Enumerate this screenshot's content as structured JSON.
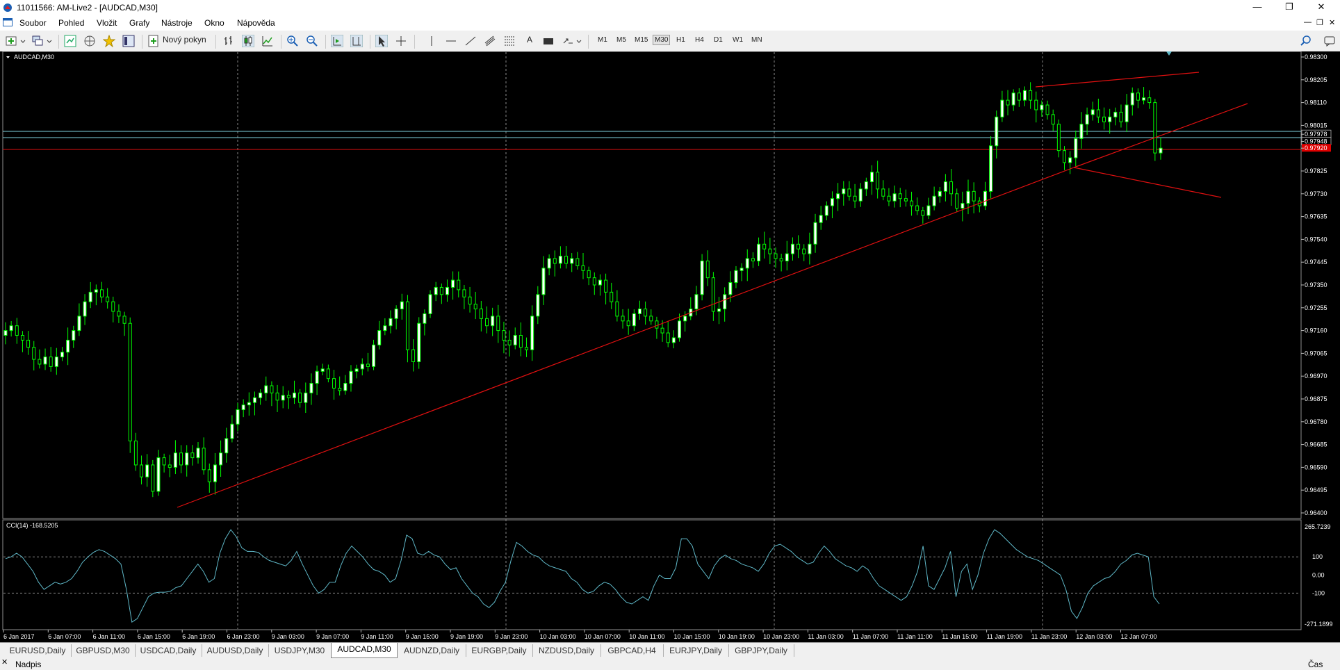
{
  "window": {
    "title": "11011566: AM-Live2 - [AUDCAD,M30]"
  },
  "menu": [
    "Soubor",
    "Pohled",
    "Vložit",
    "Grafy",
    "Nástroje",
    "Okno",
    "Nápověda"
  ],
  "toolbar": {
    "new_order_label": "Nový pokyn",
    "timeframes": [
      "M1",
      "M5",
      "M15",
      "M30",
      "H1",
      "H4",
      "D1",
      "W1",
      "MN"
    ],
    "active_timeframe": "M30",
    "text_tool_label": "A"
  },
  "chart": {
    "symbol_label": "AUDCAD,M30",
    "price_labels": [
      "0.98300",
      "0.98205",
      "0.98110",
      "0.98015",
      "0.97978",
      "0.97948",
      "0.97920",
      "0.97825",
      "0.97730",
      "0.97635",
      "0.97540",
      "0.97445",
      "0.97350",
      "0.97255",
      "0.97160",
      "0.97065",
      "0.96970",
      "0.96875",
      "0.96780",
      "0.96685",
      "0.96590",
      "0.96495",
      "0.96400"
    ],
    "current_price": "0.97920",
    "time_labels": [
      "6 Jan 2017",
      "6 Jan 07:00",
      "6 Jan 11:00",
      "6 Jan 15:00",
      "6 Jan 19:00",
      "6 Jan 23:00",
      "9 Jan 03:00",
      "9 Jan 07:00",
      "9 Jan 11:00",
      "9 Jan 15:00",
      "9 Jan 19:00",
      "9 Jan 23:00",
      "10 Jan 03:00",
      "10 Jan 07:00",
      "10 Jan 11:00",
      "10 Jan 15:00",
      "10 Jan 19:00",
      "10 Jan 23:00",
      "11 Jan 03:00",
      "11 Jan 07:00",
      "11 Jan 11:00",
      "11 Jan 15:00",
      "11 Jan 19:00",
      "11 Jan 23:00",
      "12 Jan 03:00",
      "12 Jan 07:00"
    ],
    "colors": {
      "background": "#000000",
      "candle": "#00ff00",
      "bull_body": "#ffffff",
      "trendline": "#e01010",
      "cci": "#5fb8c8",
      "ask_line": "#7fd4e0",
      "price_tag": "#e00000"
    },
    "close_series": [
      0.9716,
      0.9718,
      0.9714,
      0.9712,
      0.9709,
      0.9704,
      0.9702,
      0.9705,
      0.9701,
      0.9705,
      0.9707,
      0.9712,
      0.9716,
      0.9722,
      0.9728,
      0.9732,
      0.9733,
      0.973,
      0.9728,
      0.9724,
      0.9722,
      0.9719,
      0.967,
      0.966,
      0.9655,
      0.966,
      0.9649,
      0.9663,
      0.966,
      0.9659,
      0.9665,
      0.966,
      0.9665,
      0.9663,
      0.9667,
      0.9658,
      0.9653,
      0.966,
      0.9665,
      0.9671,
      0.9677,
      0.9683,
      0.9685,
      0.9686,
      0.9688,
      0.969,
      0.9693,
      0.969,
      0.9687,
      0.9689,
      0.9688,
      0.969,
      0.9686,
      0.969,
      0.9694,
      0.9699,
      0.97,
      0.9696,
      0.9692,
      0.9691,
      0.9694,
      0.9699,
      0.97,
      0.9702,
      0.9701,
      0.971,
      0.9716,
      0.9718,
      0.9721,
      0.9725,
      0.9728,
      0.9708,
      0.9703,
      0.9719,
      0.9723,
      0.9731,
      0.9734,
      0.9731,
      0.9734,
      0.9737,
      0.9733,
      0.973,
      0.9727,
      0.9725,
      0.9721,
      0.9718,
      0.9722,
      0.9716,
      0.9712,
      0.971,
      0.9714,
      0.9709,
      0.9708,
      0.9722,
      0.9731,
      0.9742,
      0.9746,
      0.9744,
      0.9747,
      0.9744,
      0.9746,
      0.9743,
      0.9741,
      0.9738,
      0.9735,
      0.9737,
      0.9732,
      0.9728,
      0.9722,
      0.972,
      0.9718,
      0.9723,
      0.9725,
      0.9722,
      0.972,
      0.9717,
      0.9715,
      0.9711,
      0.9713,
      0.972,
      0.9722,
      0.9725,
      0.9731,
      0.9745,
      0.9738,
      0.9724,
      0.9725,
      0.9731,
      0.9736,
      0.9741,
      0.9742,
      0.9746,
      0.9745,
      0.9752,
      0.975,
      0.9748,
      0.9746,
      0.9745,
      0.9748,
      0.9752,
      0.975,
      0.9748,
      0.9752,
      0.9761,
      0.9764,
      0.9768,
      0.9771,
      0.9773,
      0.9775,
      0.9772,
      0.977,
      0.9775,
      0.9778,
      0.9782,
      0.9775,
      0.9772,
      0.977,
      0.9773,
      0.9771,
      0.977,
      0.9768,
      0.9766,
      0.9764,
      0.9768,
      0.9772,
      0.9774,
      0.9778,
      0.9773,
      0.9767,
      0.9769,
      0.9774,
      0.977,
      0.9768,
      0.9774,
      0.9793,
      0.9805,
      0.9812,
      0.981,
      0.9815,
      0.9812,
      0.9816,
      0.9812,
      0.9808,
      0.981,
      0.9806,
      0.9802,
      0.9791,
      0.9786,
      0.9788,
      0.9796,
      0.9802,
      0.9806,
      0.9808,
      0.9805,
      0.9803,
      0.9805,
      0.9807,
      0.9803,
      0.981,
      0.9815,
      0.9812,
      0.9813,
      0.9811,
      0.979,
      0.9792
    ],
    "cci_label": "CCI(14) -168.5205",
    "cci_levels": [
      "265.7239",
      "100",
      "0.00",
      "-100",
      "-271.1899"
    ],
    "cci_series": [
      90,
      100,
      120,
      100,
      60,
      20,
      -40,
      -80,
      -60,
      -40,
      -50,
      -40,
      -20,
      20,
      70,
      100,
      125,
      140,
      130,
      110,
      90,
      60,
      -80,
      -260,
      -240,
      -180,
      -120,
      -100,
      -95,
      -95,
      -90,
      -70,
      -60,
      -20,
      20,
      60,
      20,
      -40,
      -20,
      120,
      200,
      250,
      210,
      150,
      130,
      130,
      125,
      100,
      80,
      70,
      60,
      50,
      80,
      130,
      60,
      0,
      -60,
      -100,
      -80,
      -40,
      -40,
      50,
      120,
      160,
      130,
      100,
      60,
      30,
      20,
      0,
      -40,
      -20,
      80,
      220,
      200,
      120,
      110,
      130,
      110,
      100,
      60,
      30,
      40,
      -20,
      -60,
      -100,
      -120,
      -160,
      -180,
      -150,
      -90,
      -40,
      80,
      180,
      160,
      130,
      110,
      100,
      70,
      50,
      40,
      30,
      20,
      -20,
      -40,
      -80,
      -100,
      -90,
      -60,
      -40,
      -50,
      -80,
      -120,
      -150,
      -160,
      -140,
      -120,
      -140,
      -60,
      0,
      -20,
      -20,
      40,
      200,
      200,
      160,
      60,
      20,
      -20,
      50,
      90,
      110,
      90,
      80,
      60,
      50,
      40,
      20,
      60,
      120,
      160,
      170,
      150,
      130,
      100,
      80,
      60,
      70,
      120,
      160,
      130,
      90,
      70,
      50,
      40,
      20,
      50,
      30,
      -20,
      -60,
      -80,
      -100,
      -120,
      -140,
      -120,
      -60,
      20,
      160,
      -60,
      -80,
      -20,
      40,
      130,
      -120,
      20,
      60,
      -80,
      0,
      120,
      200,
      250,
      230,
      200,
      170,
      140,
      120,
      100,
      90,
      80,
      60,
      40,
      20,
      0,
      -80,
      -200,
      -240,
      -180,
      -100,
      -60,
      -40,
      -20,
      -10,
      20,
      60,
      80,
      110,
      120,
      110,
      100,
      -120,
      -160
    ]
  },
  "symbol_tabs": [
    "EURUSD,Daily",
    "GBPUSD,M30",
    "USDCAD,Daily",
    "AUDUSD,Daily",
    "USDJPY,M30",
    "AUDCAD,M30",
    "AUDNZD,Daily",
    "EURGBP,Daily",
    "NZDUSD,Daily",
    "GBPCAD,H4",
    "EURJPY,Daily",
    "GBPJPY,Daily"
  ],
  "active_tab": "AUDCAD,M30",
  "status": {
    "left": "Nadpis",
    "right": "Čas"
  }
}
